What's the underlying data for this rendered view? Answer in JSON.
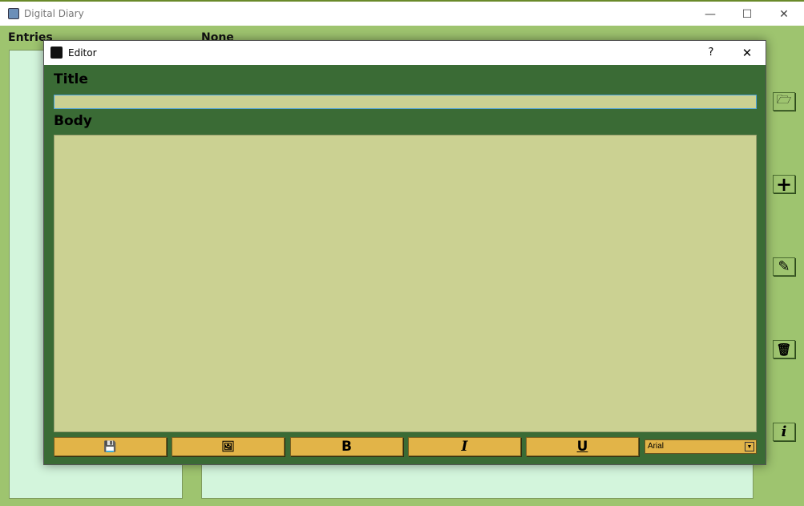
{
  "window": {
    "title": "Digital Diary",
    "minimize": "—",
    "maximize": "☐",
    "close": "✕"
  },
  "main": {
    "entries_label": "Entries",
    "entry_title": "None"
  },
  "side_buttons": [
    {
      "name": "open-button",
      "icon": "folder-open-icon",
      "glyph": "🗁"
    },
    {
      "name": "add-button",
      "icon": "plus-icon",
      "glyph": "+"
    },
    {
      "name": "edit-button",
      "icon": "edit-icon",
      "glyph": "✎"
    },
    {
      "name": "delete-button",
      "icon": "trash-icon",
      "glyph": "🗑"
    },
    {
      "name": "info-button",
      "icon": "info-icon",
      "glyph": "i"
    }
  ],
  "editor": {
    "title": "Editor",
    "help": "?",
    "close": "✕",
    "title_label": "Title",
    "title_value": "",
    "body_label": "Body",
    "body_value": "",
    "toolbar": {
      "save": "💾",
      "image": "🖼",
      "bold": "B",
      "italic": "I",
      "underline": "U",
      "font": "Arial",
      "font_arrow": "▼"
    }
  }
}
